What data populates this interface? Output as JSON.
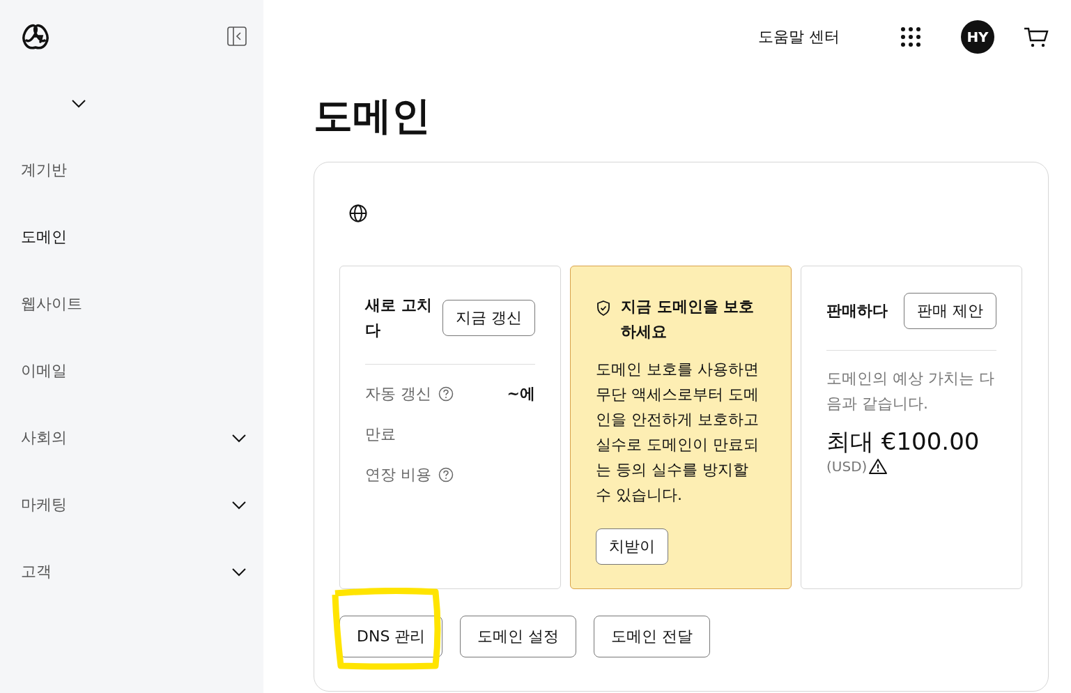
{
  "sidebar": {
    "account": {
      "expanded": false
    },
    "items": [
      {
        "label": "계기반",
        "selected": false,
        "expandable": false
      },
      {
        "label": "도메인",
        "selected": true,
        "expandable": false
      },
      {
        "label": "웹사이트",
        "selected": false,
        "expandable": false
      },
      {
        "label": "이메일",
        "selected": false,
        "expandable": false
      },
      {
        "label": "사회의",
        "selected": false,
        "expandable": true
      },
      {
        "label": "마케팅",
        "selected": false,
        "expandable": true
      },
      {
        "label": "고객",
        "selected": false,
        "expandable": true
      }
    ]
  },
  "header": {
    "help_link": "도움말 센터",
    "avatar": "HY"
  },
  "page_title": "도메인",
  "domain_card": {
    "renewal": {
      "title": "새로 고치다",
      "button": "지금 갱신",
      "rows": [
        {
          "label": "자동 갱신",
          "help": true,
          "value": "~에"
        },
        {
          "label": "만료",
          "help": false
        },
        {
          "label": "연장 비용",
          "help": true
        }
      ]
    },
    "protection": {
      "title": "지금 도메인을 보호하세요",
      "description": "도메인 보호를 사용하면 무단 액세스로부터 도메인을 안전하게 보호하고 실수로 도메인이 만료되는 등의 실수를 방지할 수 있습니다.",
      "button": "치받이"
    },
    "sell": {
      "title": "판매하다",
      "button": "판매 제안",
      "description": "도메인의 예상 가치는 다음과 같습니다.",
      "estimate": "최대 €100.00",
      "currency": "(USD)"
    },
    "actions": [
      {
        "label": "DNS 관리",
        "highlighted": true
      },
      {
        "label": "도메인 설정",
        "highlighted": false
      },
      {
        "label": "도메인 전달",
        "highlighted": false
      }
    ]
  }
}
